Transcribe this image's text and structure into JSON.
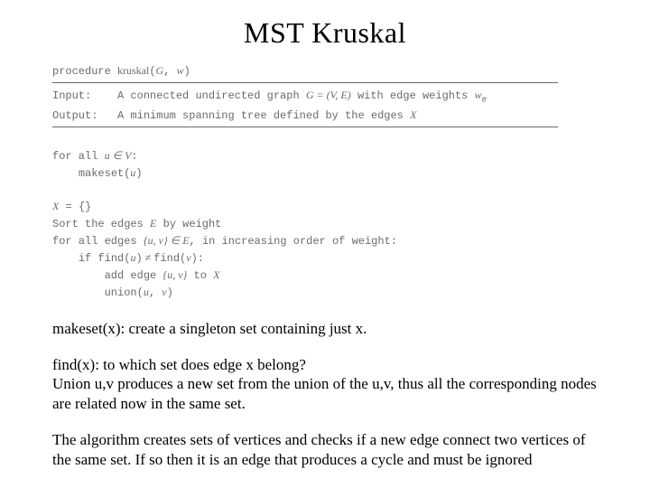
{
  "title": "MST Kruskal",
  "pseudo": {
    "proc_kw": "procedure ",
    "proc_name": "kruskal",
    "proc_args_open": "(",
    "proc_arg1": "G",
    "proc_args_sep": ", ",
    "proc_arg2": "w",
    "proc_args_close": ")",
    "input_label": "Input:",
    "input_text1": "A connected undirected graph ",
    "input_graph": "G = (V, E)",
    "input_text2": " with edge weights ",
    "input_we": "w",
    "input_we_sub": "e",
    "output_label": "Output:",
    "output_text1": "A minimum spanning tree defined by the edges ",
    "output_X": "X",
    "forall1_a": "for all ",
    "forall1_b": "u ∈ V",
    "forall1_c": ":",
    "makeset_a": "makeset(",
    "makeset_u": "u",
    "makeset_b": ")",
    "xinit_a": "X",
    "xinit_b": " = {}",
    "sort_a": "Sort the edges ",
    "sort_E": "E",
    "sort_b": " by weight",
    "forall2_a": "for all edges ",
    "forall2_set": "{u, v} ∈ E",
    "forall2_b": ", in increasing order of weight:",
    "if_a": "if ",
    "if_find1": "find(",
    "if_u": "u",
    "if_find1b": ")",
    "if_neq": " ≠ ",
    "if_find2": "find(",
    "if_v": "v",
    "if_find2b": ")",
    "if_c": ":",
    "add_a": "add edge ",
    "add_set": "{u, v}",
    "add_b": " to ",
    "add_X": "X",
    "union_a": "union(",
    "union_u": "u",
    "union_sep": ", ",
    "union_v": "v",
    "union_b": ")"
  },
  "body": {
    "p1": "makeset(x): create a singleton set containing just x.",
    "p2a": "find(x): to which set does edge x belong?",
    "p2b": "Union u,v produces a new set from the union of the u,v, thus all the corresponding nodes are related now in the same set.",
    "p3": "The algorithm creates sets of vertices and checks if a new edge connect two vertices of the same set. If so then it is an edge that produces a cycle and  must be ignored"
  }
}
